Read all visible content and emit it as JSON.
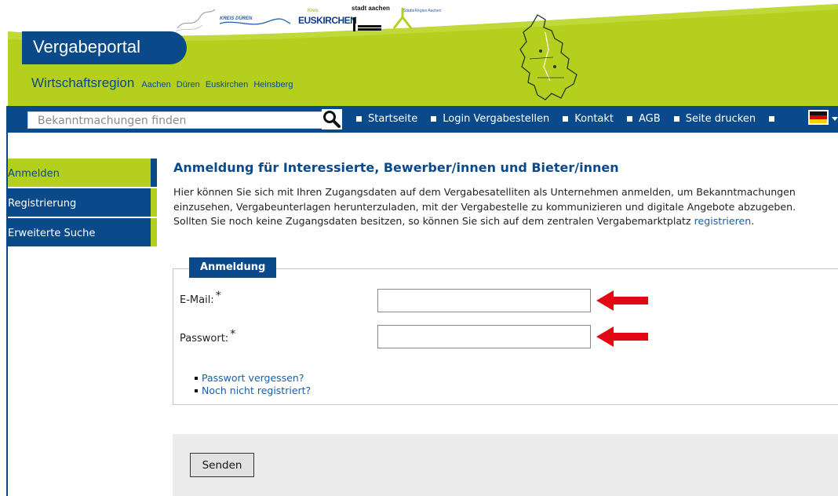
{
  "header": {
    "brand_title": "Vergabeportal",
    "region_title": "Wirtschaftsregion",
    "region_towns": [
      "Aachen",
      "Düren",
      "Euskirchen",
      "Heinsberg"
    ],
    "logos": {
      "dueren": "KREIS DÜREN",
      "euskirchen": "EUSKIRCHEN",
      "euskirchen_tag": "Kreis",
      "stadt_aachen": "stadt aachen",
      "staedteregion": "StädteRegion Aachen"
    },
    "colors": {
      "brand_blue": "#0b4a8a",
      "lime": "#b4cf1e"
    }
  },
  "search": {
    "placeholder": "Bekanntmachungen finden",
    "value": "",
    "icon": "search-icon"
  },
  "nav": {
    "items": [
      "Startseite",
      "Login Vergabestellen",
      "Kontakt",
      "AGB",
      "Seite drucken"
    ],
    "language_icon": "german-flag-icon"
  },
  "sidebar": {
    "items": [
      {
        "label": "Anmelden",
        "active": true
      },
      {
        "label": "Registrierung",
        "active": false
      },
      {
        "label": "Erweiterte Suche",
        "active": false
      }
    ]
  },
  "main": {
    "title": "Anmeldung für Interessierte, Bewerber/innen und Bieter/innen",
    "intro_1": "Hier können Sie sich mit Ihren Zugangsdaten auf dem Vergabesatelliten als Unternehmen anmelden, um Bekanntmachungen einzusehen, Vergabeunterlagen herunterzuladen, mit der Vergabestelle zu kommunizieren und digitale Angebote abzugeben. Sollten Sie noch keine Zugangsdaten besitzen, so können Sie sich auf dem zentralen Vergabemarktplatz ",
    "intro_link": "registrieren",
    "intro_end": "."
  },
  "form": {
    "legend": "Anmeldung",
    "email_label": "E-Mail:",
    "password_label": "Passwort:",
    "required_mark": "*",
    "email_value": "",
    "password_value": "",
    "links": [
      "Passwort vergessen?",
      "Noch nicht registriert?"
    ],
    "submit_label": "Senden"
  }
}
